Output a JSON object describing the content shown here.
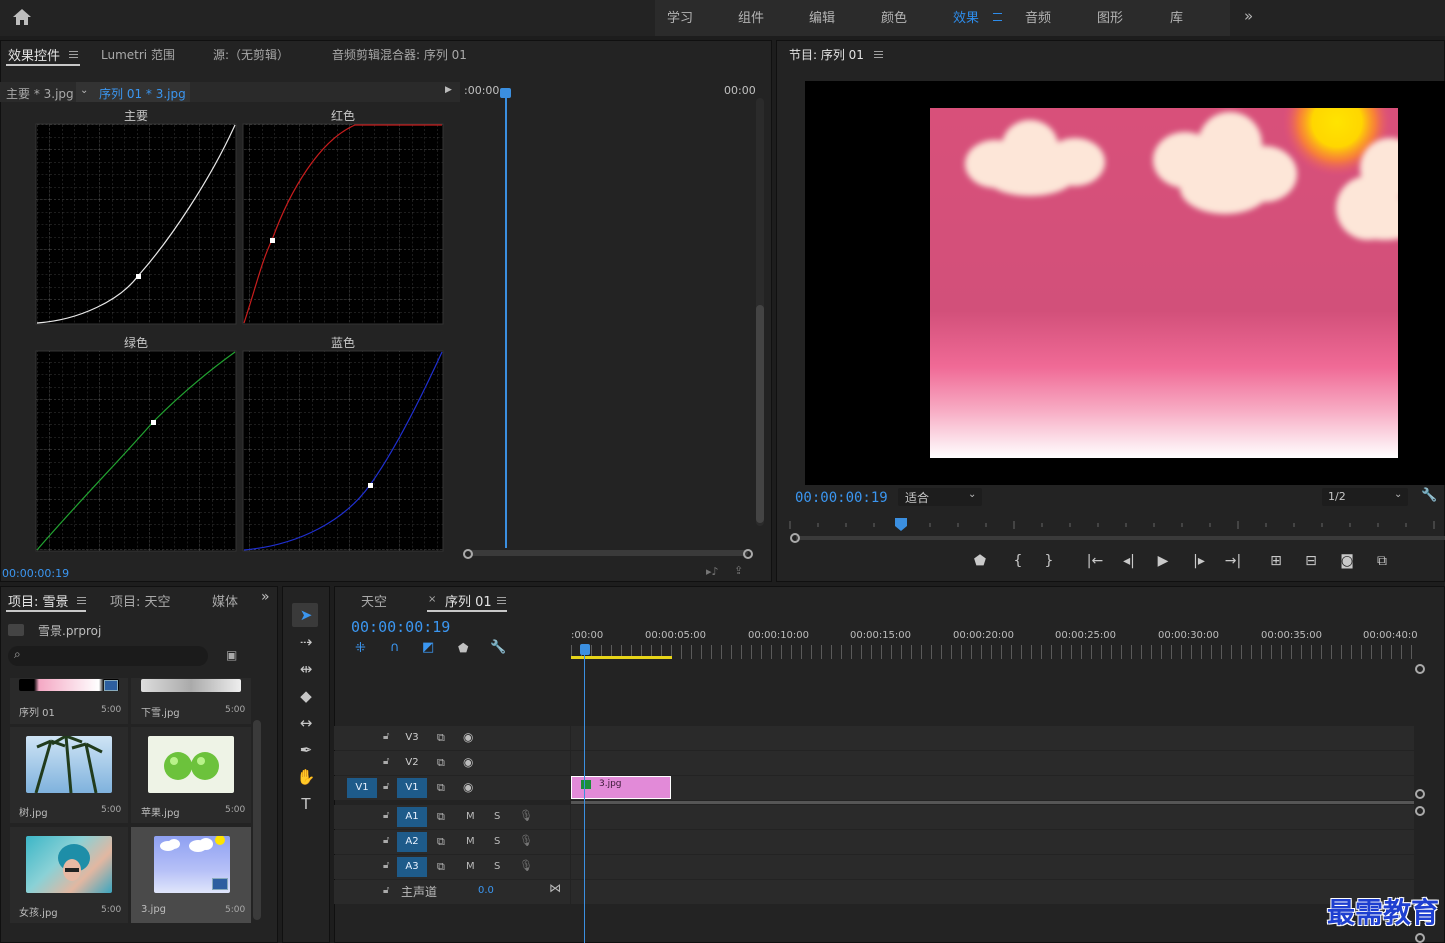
{
  "workspaces": [
    "学习",
    "组件",
    "编辑",
    "颜色",
    "效果",
    "音频",
    "图形",
    "库"
  ],
  "workspace_active": "效果",
  "effect_panel": {
    "tabs": [
      "效果控件",
      "Lumetri 范围",
      "源:（无剪辑）",
      "音频剪辑混合器: 序列 01"
    ],
    "master_clip": "主要 * 3.jpg",
    "sequence_clip": "序列 01 * 3.jpg",
    "ruler_start": ":00:00",
    "ruler_end": "00:00",
    "curves": [
      "主要",
      "红色",
      "绿色",
      "蓝色"
    ],
    "timecode": "00:00:00:19"
  },
  "program_monitor": {
    "title": "节目: 序列 01",
    "timecode": "00:00:00:19",
    "fit": "适合",
    "resolution": "1/2"
  },
  "project_panel": {
    "tabs": [
      "项目: 雪景",
      "项目: 天空",
      "媒体"
    ],
    "project_file": "雪景.prproj",
    "items": [
      {
        "name": "序列 01",
        "dur": "5:00"
      },
      {
        "name": "下雪.jpg",
        "dur": "5:00"
      },
      {
        "name": "树.jpg",
        "dur": "5:00"
      },
      {
        "name": "苹果.jpg",
        "dur": "5:00"
      },
      {
        "name": "女孩.jpg",
        "dur": "5:00"
      },
      {
        "name": "3.jpg",
        "dur": "5:00"
      }
    ]
  },
  "timeline": {
    "tabs": [
      "天空",
      "序列 01"
    ],
    "timecode": "00:00:00:19",
    "ruler": [
      ":00:00",
      "00:00:05:00",
      "00:00:10:00",
      "00:00:15:00",
      "00:00:20:00",
      "00:00:25:00",
      "00:00:30:00",
      "00:00:35:00",
      "00:00:40:0"
    ],
    "video_tracks": [
      "V3",
      "V2",
      "V1"
    ],
    "audio_tracks": [
      "A1",
      "A2",
      "A3"
    ],
    "source_patch": "V1",
    "master_label": "主声道",
    "master_value": "0.0",
    "clip_name": "3.jpg",
    "mute": "M",
    "solo": "S"
  },
  "watermark": "最需教育",
  "colors": {
    "accent": "#2d8ceb",
    "clip": "#e28ad8",
    "panel": "#232323"
  }
}
